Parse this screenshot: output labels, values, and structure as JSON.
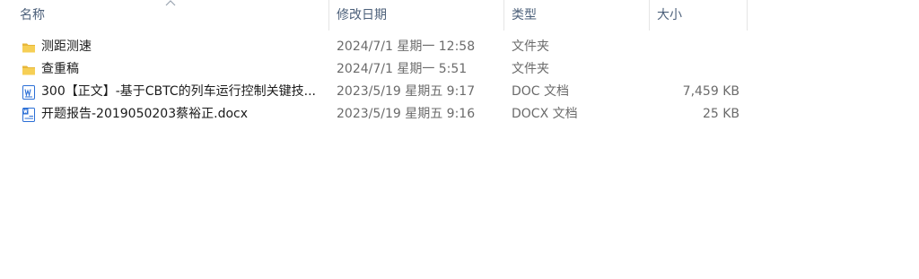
{
  "columns": {
    "name": "名称",
    "modified": "修改日期",
    "type": "类型",
    "size": "大小"
  },
  "files": [
    {
      "icon": "folder-icon",
      "name": "测距测速",
      "modified": "2024/7/1 星期一 12:58",
      "type": "文件夹",
      "size": ""
    },
    {
      "icon": "folder-icon",
      "name": "查重稿",
      "modified": "2024/7/1 星期一 5:51",
      "type": "文件夹",
      "size": ""
    },
    {
      "icon": "word-doc-icon",
      "name": "300【正文】-基于CBTC的列车运行控制关键技...",
      "modified": "2023/5/19 星期五 9:17",
      "type": "DOC 文档",
      "size": "7,459 KB"
    },
    {
      "icon": "word-doc-icon",
      "name": "开题报告-2019050203蔡裕正.docx",
      "modified": "2023/5/19 星期五 9:16",
      "type": "DOCX 文档",
      "size": "25 KB"
    }
  ],
  "colors": {
    "header_text": "#4c607a",
    "folder": "#f3c64a",
    "word_blue": "#2b6fd6"
  }
}
